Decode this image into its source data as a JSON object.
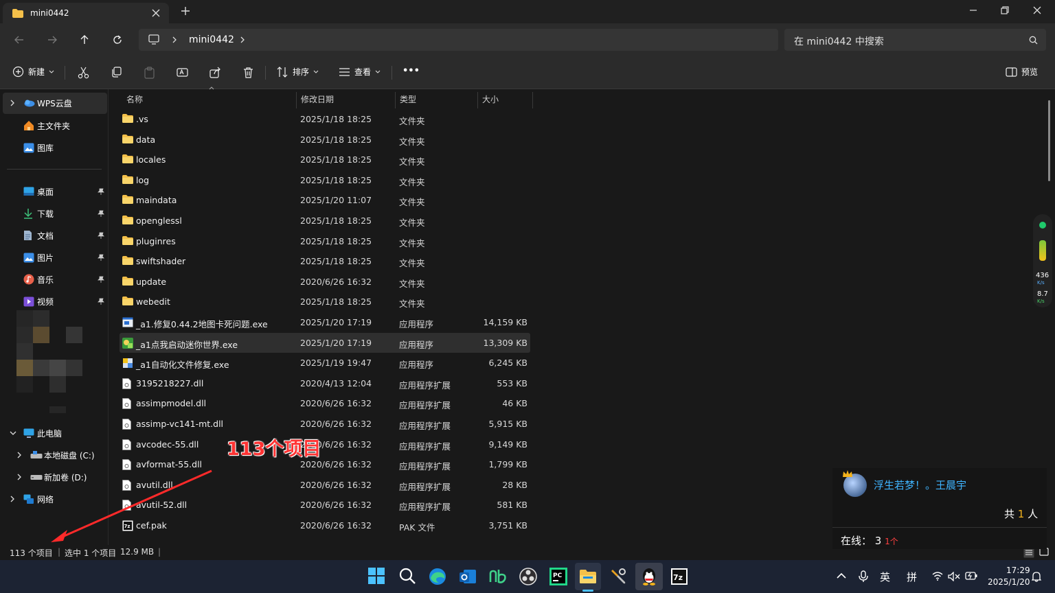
{
  "window": {
    "tab_title": "mini0442",
    "colors": {
      "background": "#191919",
      "chrome": "#2b2b2b",
      "accent": "#4cc2ff",
      "folder": "#f4c04a"
    }
  },
  "address": {
    "breadcrumb": "mini0442",
    "search_placeholder": "在 mini0442 中搜索"
  },
  "toolbar": {
    "new_label": "新建",
    "sort_label": "排序",
    "view_label": "查看",
    "more_label": "•••",
    "preview_label": "预览"
  },
  "sidebar": {
    "top_items": [
      {
        "label": "WPS云盘",
        "icon": "cloud-icon"
      },
      {
        "label": "主文件夹",
        "icon": "home-icon"
      },
      {
        "label": "图库",
        "icon": "gallery-icon"
      }
    ],
    "quick_access": [
      {
        "label": "桌面",
        "icon": "desktop-icon"
      },
      {
        "label": "下载",
        "icon": "download-icon"
      },
      {
        "label": "文档",
        "icon": "documents-icon"
      },
      {
        "label": "图片",
        "icon": "pictures-icon"
      },
      {
        "label": "音乐",
        "icon": "music-icon"
      },
      {
        "label": "视频",
        "icon": "video-icon"
      }
    ],
    "this_pc": "此电脑",
    "drives": [
      {
        "label": "本地磁盘 (C:)",
        "icon": "drive-icon"
      },
      {
        "label": "新加卷 (D:)",
        "icon": "drive-icon"
      }
    ],
    "network": "网络"
  },
  "columns": {
    "name": "名称",
    "date": "修改日期",
    "type": "类型",
    "size": "大小"
  },
  "files": [
    {
      "name": ".vs",
      "date": "2025/1/18 18:25",
      "type": "文件夹",
      "size": "",
      "kind": "folder"
    },
    {
      "name": "data",
      "date": "2025/1/18 18:25",
      "type": "文件夹",
      "size": "",
      "kind": "folder"
    },
    {
      "name": "locales",
      "date": "2025/1/18 18:25",
      "type": "文件夹",
      "size": "",
      "kind": "folder"
    },
    {
      "name": "log",
      "date": "2025/1/18 18:25",
      "type": "文件夹",
      "size": "",
      "kind": "folder"
    },
    {
      "name": "maindata",
      "date": "2025/1/20 11:07",
      "type": "文件夹",
      "size": "",
      "kind": "folder"
    },
    {
      "name": "openglessl",
      "date": "2025/1/18 18:25",
      "type": "文件夹",
      "size": "",
      "kind": "folder"
    },
    {
      "name": "pluginres",
      "date": "2025/1/18 18:25",
      "type": "文件夹",
      "size": "",
      "kind": "folder"
    },
    {
      "name": "swiftshader",
      "date": "2025/1/18 18:25",
      "type": "文件夹",
      "size": "",
      "kind": "folder"
    },
    {
      "name": "update",
      "date": "2020/6/26 16:32",
      "type": "文件夹",
      "size": "",
      "kind": "folder"
    },
    {
      "name": "webedit",
      "date": "2025/1/18 18:25",
      "type": "文件夹",
      "size": "",
      "kind": "folder"
    },
    {
      "name": "_a1.修复0.44.2地图卡死问题.exe",
      "date": "2025/1/20 17:19",
      "type": "应用程序",
      "size": "14,159 KB",
      "kind": "exe"
    },
    {
      "name": "_a1点我启动迷你世界.exe",
      "date": "2025/1/20 17:19",
      "type": "应用程序",
      "size": "13,309 KB",
      "kind": "exe2",
      "selected": true
    },
    {
      "name": "_a1自动化文件修复.exe",
      "date": "2025/1/19 19:47",
      "type": "应用程序",
      "size": "6,245 KB",
      "kind": "exe3"
    },
    {
      "name": "3195218227.dll",
      "date": "2020/4/13 12:04",
      "type": "应用程序扩展",
      "size": "553 KB",
      "kind": "dll"
    },
    {
      "name": "assimpmodel.dll",
      "date": "2020/6/26 16:32",
      "type": "应用程序扩展",
      "size": "46 KB",
      "kind": "dll"
    },
    {
      "name": "assimp-vc141-mt.dll",
      "date": "2020/6/26 16:32",
      "type": "应用程序扩展",
      "size": "5,915 KB",
      "kind": "dll"
    },
    {
      "name": "avcodec-55.dll",
      "date": "2020/6/26 16:32",
      "type": "应用程序扩展",
      "size": "9,149 KB",
      "kind": "dll"
    },
    {
      "name": "avformat-55.dll",
      "date": "2020/6/26 16:32",
      "type": "应用程序扩展",
      "size": "1,799 KB",
      "kind": "dll"
    },
    {
      "name": "avutil.dll",
      "date": "2020/6/26 16:32",
      "type": "应用程序扩展",
      "size": "28 KB",
      "kind": "dll"
    },
    {
      "name": "avutil-52.dll",
      "date": "2020/6/26 16:32",
      "type": "应用程序扩展",
      "size": "581 KB",
      "kind": "dll"
    },
    {
      "name": "cef.pak",
      "date": "2020/6/26 16:32",
      "type": "PAK 文件",
      "size": "3,751 KB",
      "kind": "pak"
    }
  ],
  "status": {
    "item_count": "113 个项目",
    "selection": "选中 1 个项目",
    "selection_size": "12.9 MB"
  },
  "annotation": "113个项目",
  "speed_widget": {
    "up": "436",
    "up_unit": "K/s",
    "down": "8.7",
    "down_unit": "K/s"
  },
  "chat_popup": {
    "name": "浮生若梦！。王晨宇",
    "total_prefix": "共",
    "total_count": "1",
    "total_suffix": "人",
    "online_label": "在线：",
    "online_count": "3",
    "online_delta": "1个"
  },
  "taskbar": {
    "apps": [
      "start-icon",
      "search-icon",
      "edge-icon",
      "outlook-icon",
      "app-nb-icon",
      "obs-icon",
      "pycharm-icon",
      "file-explorer-icon",
      "tools-icon",
      "qq-icon",
      "7zip-icon"
    ],
    "ime_lang": "英",
    "ime_mode": "拼",
    "time": "17:29",
    "date": "2025/1/20"
  }
}
